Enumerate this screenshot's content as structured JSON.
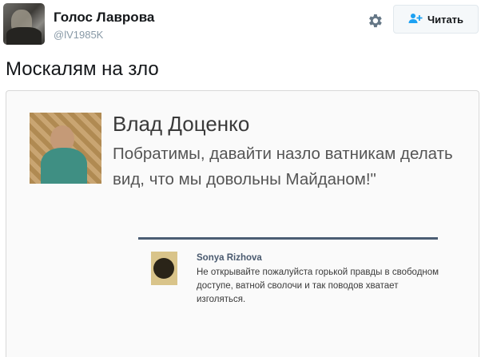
{
  "tweet": {
    "user_name": "Голос Лаврова",
    "handle": "@lV1985K",
    "follow_label": "Читать",
    "text": "Москалям на зло"
  },
  "embedded_post": {
    "author": "Влад Доценко",
    "body": "Побратимы, давайти назло ватникам делать вид, что мы довольны Майданом!\"",
    "comment": {
      "author": "Sonya Rizhova",
      "body": "Не открывайте пожалуйста горькой правды в свободном доступе, ватной сволочи и так поводов хватает изголяться."
    }
  },
  "icons": {
    "settings": "gear-icon",
    "follow": "add-user-icon"
  },
  "colors": {
    "accent": "#1da1f2",
    "handle": "#8899a6"
  }
}
